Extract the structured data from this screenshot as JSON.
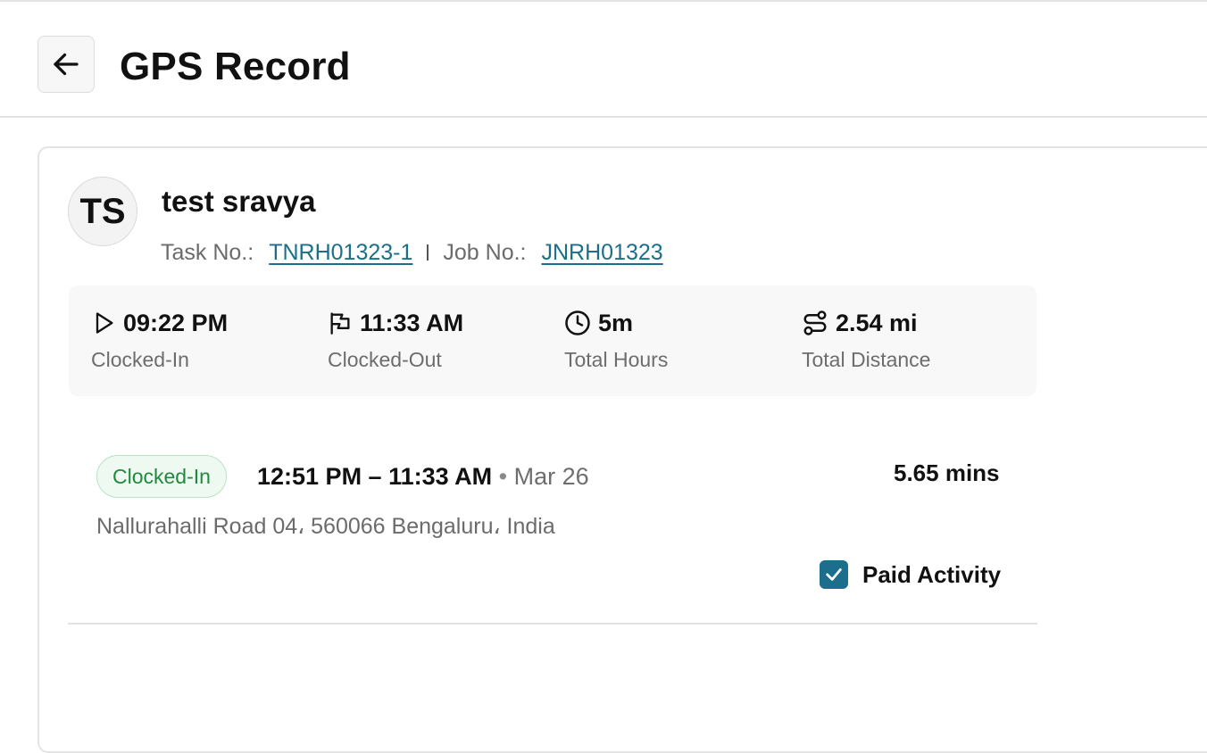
{
  "header": {
    "back_icon": "arrow-left-icon",
    "title": "GPS Record"
  },
  "user": {
    "initials": "TS",
    "name": "test sravya",
    "task_label": "Task No.:",
    "task_no": "TNRH01323-1",
    "job_label": "Job No.:",
    "job_no": "JNRH01323"
  },
  "stats": [
    {
      "icon": "play-icon",
      "value": "09:22 PM",
      "label": "Clocked-In"
    },
    {
      "icon": "flag-icon",
      "value": "11:33 AM",
      "label": "Clocked-Out"
    },
    {
      "icon": "clock-icon",
      "value": "5m",
      "label": "Total Hours"
    },
    {
      "icon": "route-icon",
      "value": "2.54 mi",
      "label": "Total Distance"
    }
  ],
  "activity": {
    "status": "Clocked-In",
    "time_range": "12:51 PM – 11:33 AM",
    "separator": "•",
    "date": "Mar 26",
    "duration": "5.65 mins",
    "address": "Nallurahalli Road 04، 560066 Bengaluru، India",
    "paid_label": "Paid Activity",
    "paid_checked": true
  },
  "colors": {
    "link": "#1b6f8c",
    "badge_text": "#1f8a3e",
    "badge_bg": "#eefaf1",
    "checkbox": "#1b6f8c"
  }
}
